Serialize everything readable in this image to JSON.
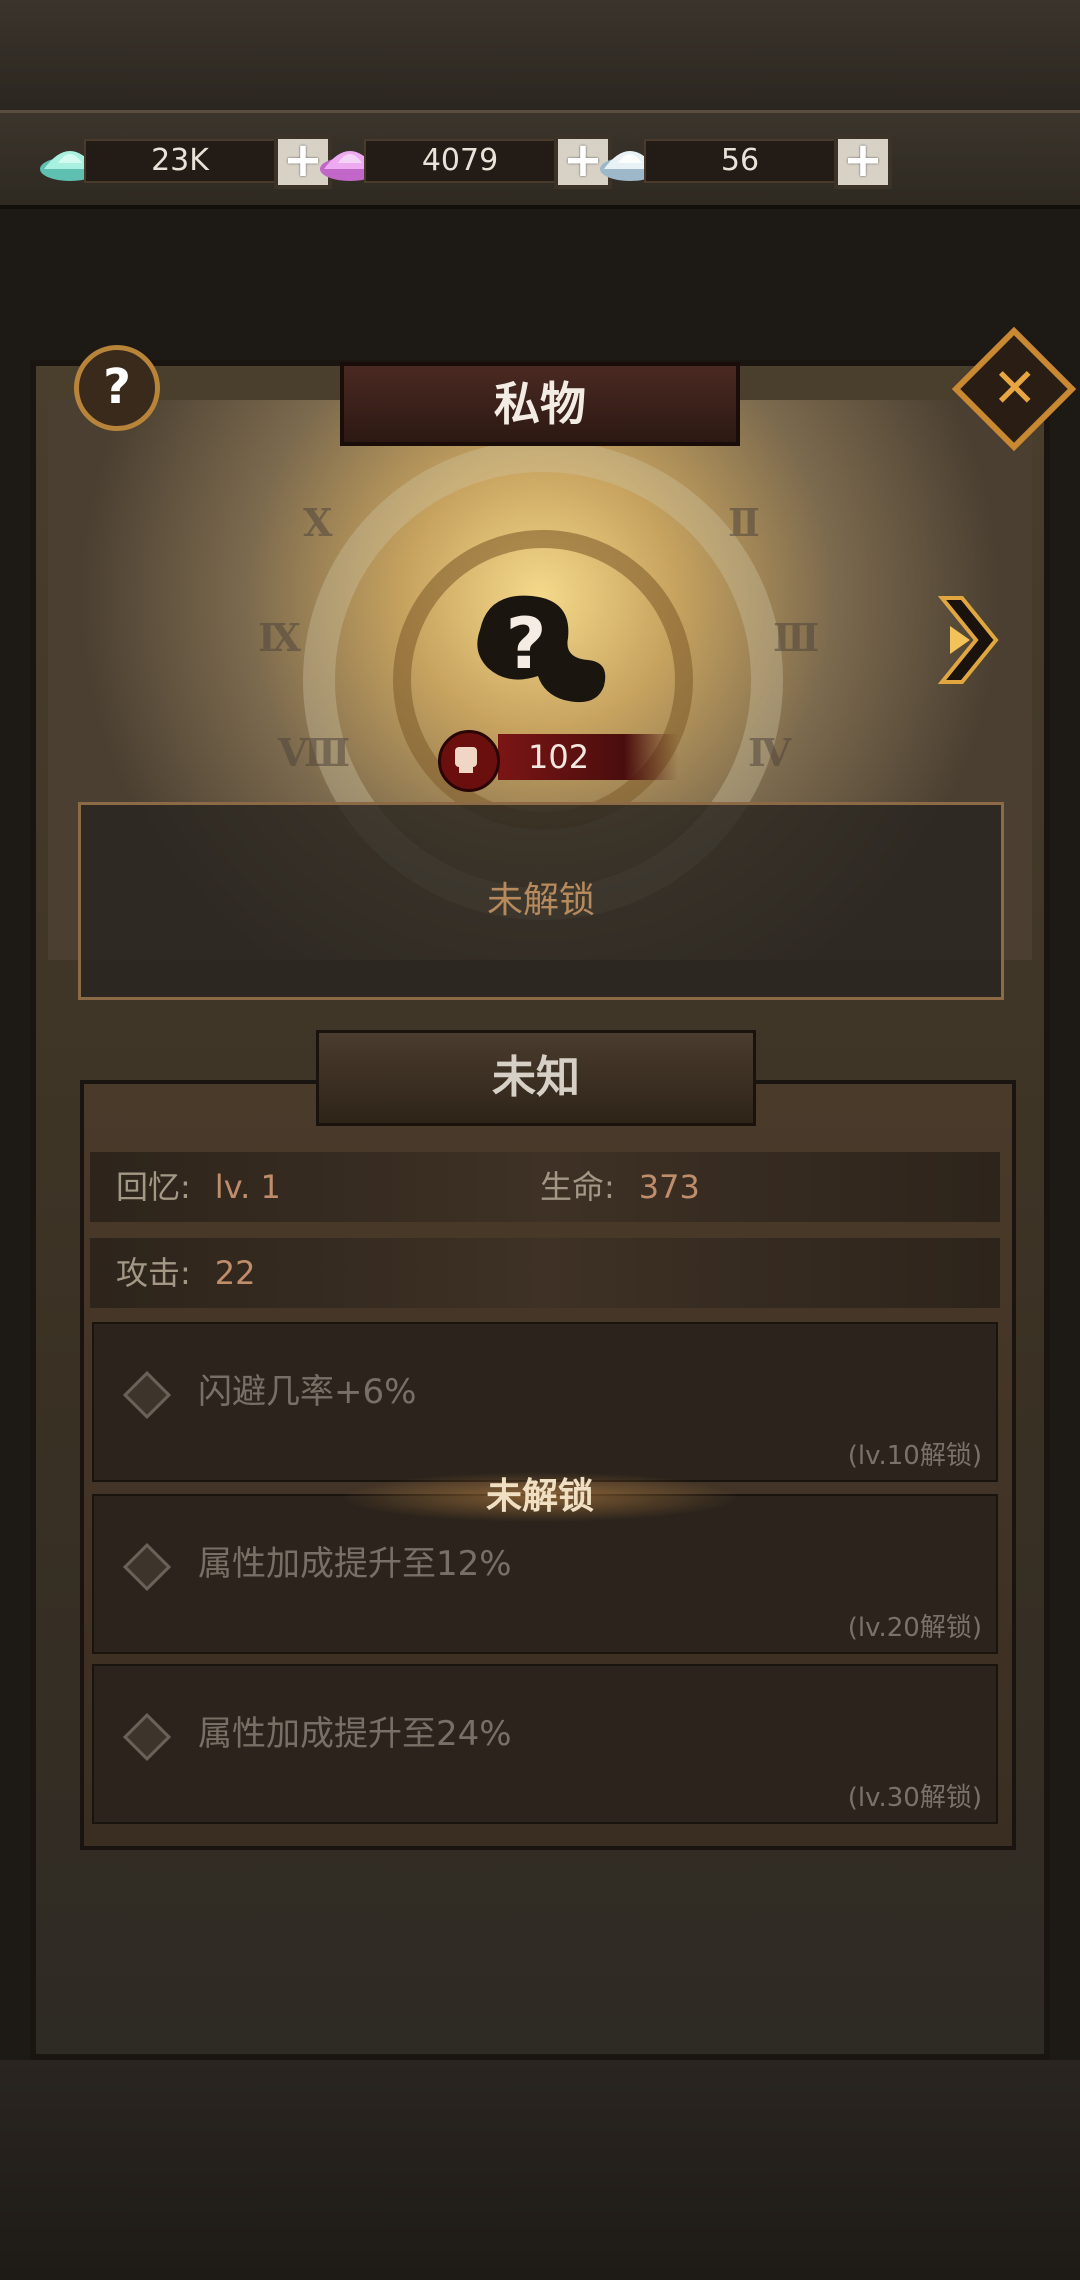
{
  "currencies": [
    {
      "icon": "blue-crystal-icon",
      "value": "23K",
      "color": "#9fe6d8"
    },
    {
      "icon": "pink-crystal-icon",
      "value": "4079",
      "color": "#e4a2e8"
    },
    {
      "icon": "white-crystal-icon",
      "value": "56",
      "color": "#e8f0f2"
    }
  ],
  "panel": {
    "title": "私物",
    "power_value": "102",
    "unlock_status": "未解锁",
    "item_name": "未知",
    "stats": {
      "memory_label": "回忆:",
      "memory_value": "lv. 1",
      "hp_label": "生命:",
      "hp_value": "373",
      "atk_label": "攻击:",
      "atk_value": "22"
    },
    "locked_section_label": "未解锁",
    "skills": [
      {
        "text": "闪避几率+6%",
        "requirement": "(lv.10解锁)"
      },
      {
        "text": "属性加成提升至12%",
        "requirement": "(lv.20解锁)"
      },
      {
        "text": "属性加成提升至24%",
        "requirement": "(lv.30解锁)"
      }
    ]
  }
}
